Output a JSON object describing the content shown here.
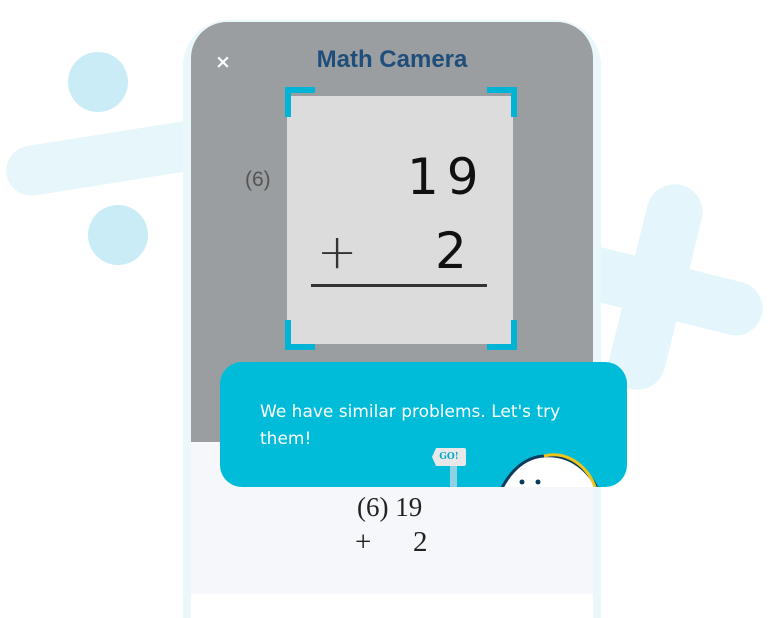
{
  "header": {
    "title": "Math Camera",
    "close_symbol": "×"
  },
  "scan": {
    "problem_number": "(6)",
    "line1": "19",
    "operator": "+",
    "line2": "2"
  },
  "result": {
    "line1": "(6) 19",
    "operator": "+",
    "line2": "2"
  },
  "popup": {
    "message": "We have similar problems. Let's try them!",
    "flag_text": "GO!"
  },
  "colors": {
    "accent": "#00bcd9",
    "title": "#1f4e7a",
    "camera_bg": "#9a9ea1"
  }
}
